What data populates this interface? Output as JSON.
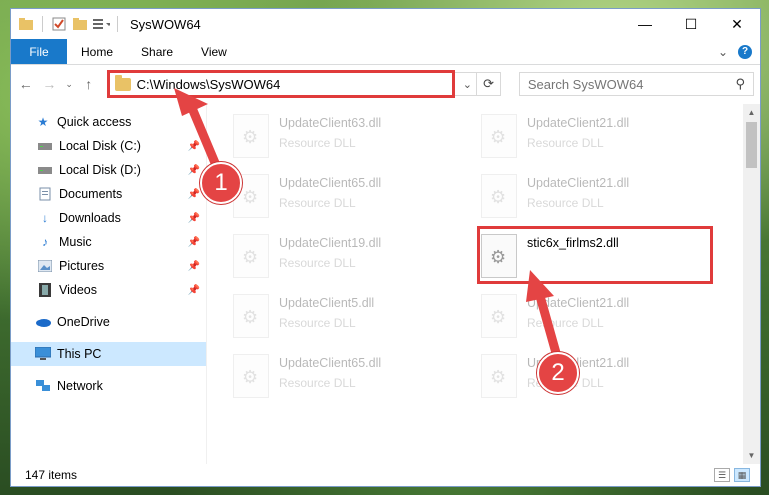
{
  "window": {
    "title": "SysWOW64",
    "controls": {
      "minimize": "—",
      "maximize": "☐",
      "close": "✕"
    }
  },
  "ribbon": {
    "file": "File",
    "tabs": [
      "Home",
      "Share",
      "View"
    ]
  },
  "address": {
    "path": "C:\\Windows\\SysWOW64"
  },
  "search": {
    "placeholder": "Search SysWOW64"
  },
  "nav": {
    "quick_access": "Quick access",
    "items": [
      {
        "label": "Local Disk (C:)",
        "icon": "drive-icon",
        "pinned": true
      },
      {
        "label": "Local Disk (D:)",
        "icon": "drive-icon",
        "pinned": true
      },
      {
        "label": "Documents",
        "icon": "documents-icon",
        "pinned": true
      },
      {
        "label": "Downloads",
        "icon": "downloads-icon",
        "pinned": true
      },
      {
        "label": "Music",
        "icon": "music-icon",
        "pinned": true
      },
      {
        "label": "Pictures",
        "icon": "pictures-icon",
        "pinned": true
      },
      {
        "label": "Videos",
        "icon": "videos-icon",
        "pinned": true
      }
    ],
    "onedrive": "OneDrive",
    "this_pc": "This PC",
    "network": "Network"
  },
  "files": [
    {
      "name": "UpdateClient63.dll",
      "type": "Resource DLL"
    },
    {
      "name": "UpdateClient21.dll",
      "type": "Resource DLL"
    },
    {
      "name": "UpdateClient65.dll",
      "type": "Resource DLL"
    },
    {
      "name": "UpdateClient21.dll",
      "type": "Resource DLL"
    },
    {
      "name": "UpdateClient19.dll",
      "type": "Resource DLL"
    },
    {
      "name": "stic6x_firlms2.dll",
      "type": ""
    },
    {
      "name": "UpdateClient5.dll",
      "type": "Resource DLL"
    },
    {
      "name": "UpdateClient21.dll",
      "type": "Resource DLL"
    },
    {
      "name": "UpdateClient65.dll",
      "type": "Resource DLL"
    },
    {
      "name": "UpdateClient21.dll",
      "type": "Resource DLL"
    }
  ],
  "status": {
    "items": "147 items"
  },
  "annotations": {
    "step1": "1",
    "step2": "2",
    "color": "#e03b3b"
  },
  "colors": {
    "accent": "#1979ca",
    "selection": "#cce8ff",
    "highlight": "#e03b3b"
  }
}
